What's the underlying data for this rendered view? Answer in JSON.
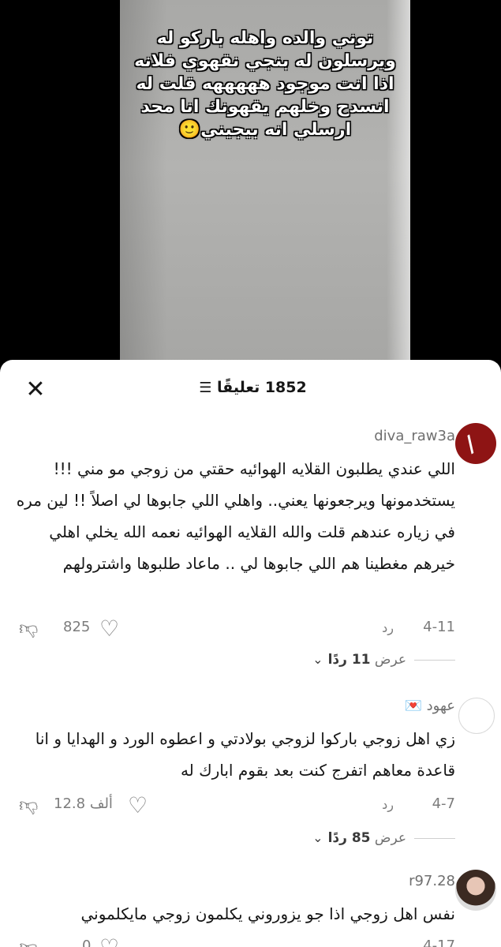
{
  "video": {
    "caption_lines": [
      "توني والده واهله باركو له",
      "ويرسلون له بنجي نقهوي فلانه",
      "اذا انت موجود هههههه قلت له",
      "انسدح وخلهم يقهونك انا محد",
      "ارسلي انه بيجيني🙂"
    ]
  },
  "comments_panel": {
    "title": "1852 تعليقًا",
    "sort_icon": "sort-lines-icon",
    "close_icon": "close-icon"
  },
  "comments": [
    {
      "username": "diva_raw3a",
      "text": "اللي عندي يطلبون القلايه الهوائيه حقتي من زوجي مو مني !!! يستخدمونها ويرجعونها يعني.. واهلي اللي جابوها لي اصلاً !! لين مره في زياره عندهم قلت والله القلايه الهوائيه نعمه الله يخلي اهلي خيرهم مغطينا هم اللي جابوها لي .. ماعاد طلبوها واشترولهم",
      "date": "4-11",
      "reply_label": "رد",
      "likes": "825",
      "view_replies": {
        "prefix": "عرض",
        "count": "11 ردًا"
      }
    },
    {
      "username": "💌 عهود",
      "text": "زي اهل زوجي باركوا لزوجي بولادتي و اعطوه الورد و الهدايا و انا قاعدة معاهم اتفرج كنت بعد بقوم ابارك له",
      "date": "4-7",
      "reply_label": "رد",
      "likes": "12.8 ألف",
      "view_replies": {
        "prefix": "عرض",
        "count": "85 ردًا"
      }
    },
    {
      "username": "r97.28",
      "text": "نفس اهل زوجي اذا جو يزوروني يكلمون زوجي مايكلموني",
      "date": "4-17",
      "likes": "0"
    }
  ]
}
